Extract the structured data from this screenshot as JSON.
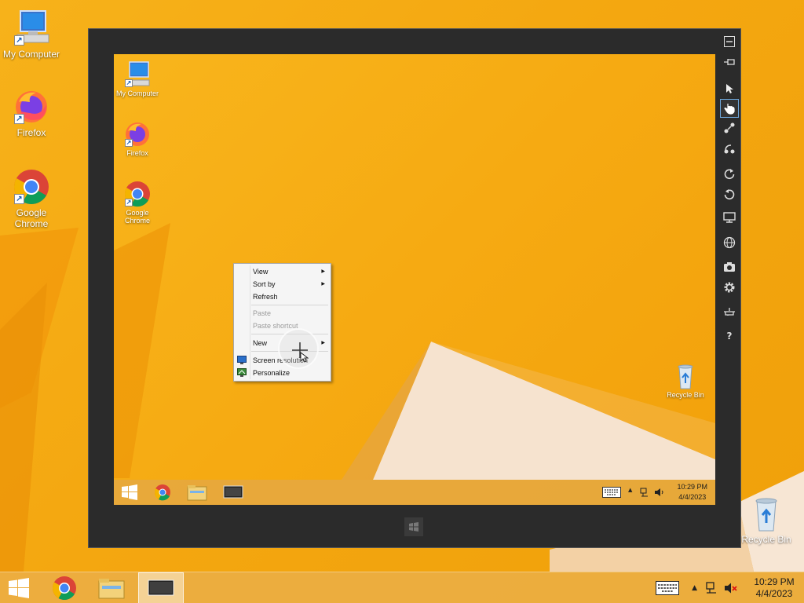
{
  "outer_desktop": {
    "icons": [
      {
        "label": "My Computer",
        "icon": "computer-icon"
      },
      {
        "label": "Firefox",
        "icon": "firefox-icon"
      },
      {
        "label": "Google Chrome",
        "icon": "chrome-icon"
      },
      {
        "label": "Recycle Bin",
        "icon": "recycle-bin-icon"
      }
    ],
    "taskbar": {
      "buttons": [
        {
          "icon": "windows-start-icon"
        },
        {
          "icon": "chrome-icon"
        },
        {
          "icon": "file-explorer-icon"
        },
        {
          "icon": "remote-desktop-icon",
          "active": true
        }
      ],
      "time": "10:29 PM",
      "date": "4/4/2023"
    }
  },
  "remote_window": {
    "toolbar": [
      {
        "icon": "minimize-icon"
      },
      {
        "icon": "pin-icon"
      },
      {
        "icon": "pointer-icon"
      },
      {
        "icon": "hand-icon",
        "selected": true
      },
      {
        "icon": "pinch-icon"
      },
      {
        "icon": "rotate-gesture-icon"
      },
      {
        "icon": "rotate-clockwise-icon"
      },
      {
        "icon": "rotate-counterclockwise-icon"
      },
      {
        "icon": "monitor-icon"
      },
      {
        "icon": "globe-icon"
      },
      {
        "icon": "camera-icon"
      },
      {
        "icon": "settings-gear-icon"
      },
      {
        "icon": "network-icon"
      },
      {
        "icon": "help-icon",
        "text": "?"
      }
    ],
    "inner_desktop": {
      "icons": [
        {
          "label": "My Computer",
          "icon": "computer-icon"
        },
        {
          "label": "Firefox",
          "icon": "firefox-icon"
        },
        {
          "label": "Google Chrome",
          "icon": "chrome-icon"
        },
        {
          "label": "Recycle Bin",
          "icon": "recycle-bin-icon"
        }
      ],
      "context_menu": {
        "items": [
          {
            "label": "View",
            "submenu": true
          },
          {
            "label": "Sort by",
            "submenu": true
          },
          {
            "label": "Refresh"
          },
          {
            "label": "Paste",
            "disabled": true
          },
          {
            "label": "Paste shortcut",
            "disabled": true
          },
          {
            "label": "New",
            "submenu": true
          },
          {
            "label": "Screen resolution"
          },
          {
            "label": "Personalize"
          }
        ]
      },
      "taskbar": {
        "time": "10:29 PM",
        "date": "4/4/2023"
      }
    }
  },
  "colors": {
    "wallpaper": "#f5ab13",
    "window_frame": "#2b2b2b",
    "menu_bg": "#f5f5f5"
  }
}
